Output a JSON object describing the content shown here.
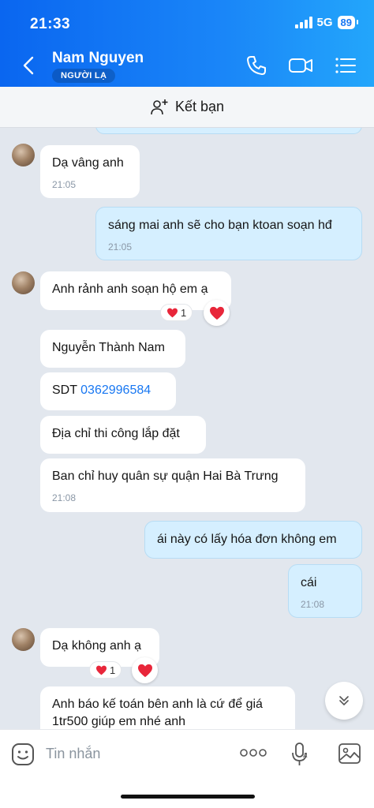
{
  "status_bar": {
    "time": "21:33",
    "network": "5G",
    "battery": "89"
  },
  "header": {
    "contact_name": "Nam Nguyen",
    "badge": "NGƯỜI LẠ"
  },
  "add_friend": {
    "label": "Kết bạn"
  },
  "messages": [
    {
      "dir": "in",
      "text": "Dạ vâng anh",
      "time": "21:05"
    },
    {
      "dir": "out",
      "text": "sáng mai anh sẽ cho bạn ktoan soạn hđ",
      "time": "21:05"
    },
    {
      "dir": "in",
      "text": "Anh rảnh anh soạn hộ em ạ",
      "reaction": {
        "emoji": "heart",
        "count": "1"
      }
    },
    {
      "dir": "in",
      "text": "Nguyễn Thành Nam"
    },
    {
      "dir": "in",
      "prefix": "SDT ",
      "phone": "0362996584"
    },
    {
      "dir": "in",
      "text": "Địa chỉ thi công lắp đặt"
    },
    {
      "dir": "in",
      "text": "Ban chỉ huy quân sự quận Hai Bà Trưng",
      "time": "21:08"
    },
    {
      "dir": "out",
      "text": "ái này có lấy hóa đơn không em"
    },
    {
      "dir": "out",
      "text": "cái",
      "time": "21:08"
    },
    {
      "dir": "in",
      "text": "Dạ không anh ạ",
      "reaction": {
        "emoji": "heart",
        "count": "1"
      }
    },
    {
      "dir": "in",
      "lines": [
        "Anh báo kế toán bên anh là cứ để giá",
        "1tr500 giúp em nhé anh"
      ]
    }
  ],
  "input": {
    "placeholder": "Tin nhắn"
  },
  "colors": {
    "header_start": "#0a66f0",
    "header_end": "#23a6fb",
    "out_bubble": "#d5efff",
    "link": "#1877f2",
    "heart": "#e8263a"
  }
}
